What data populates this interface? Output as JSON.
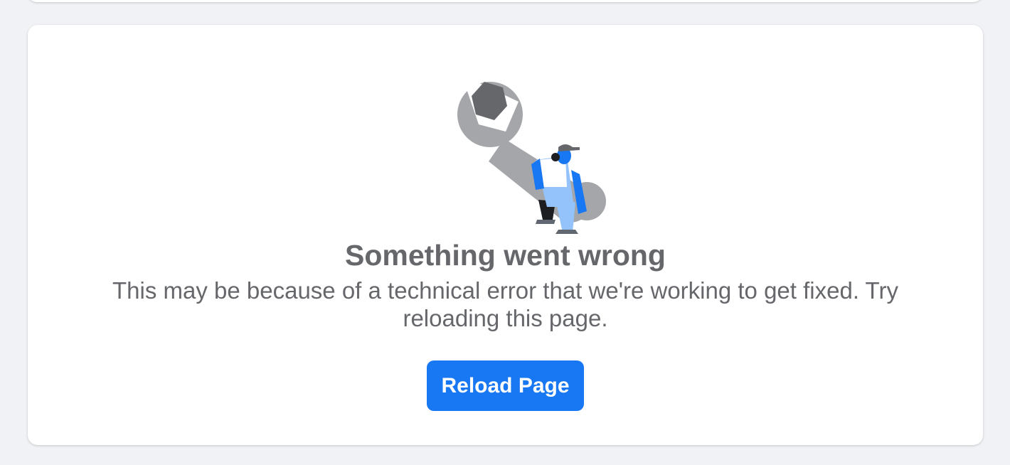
{
  "error": {
    "title": "Something went wrong",
    "message": "This may be because of a technical error that we're working to get fixed. Try reloading this page.",
    "reload_label": "Reload Page",
    "illustration_icon": "wrench-worker-icon"
  },
  "colors": {
    "background": "#f0f2f5",
    "card": "#ffffff",
    "text": "#65676b",
    "accent": "#1877f2"
  }
}
